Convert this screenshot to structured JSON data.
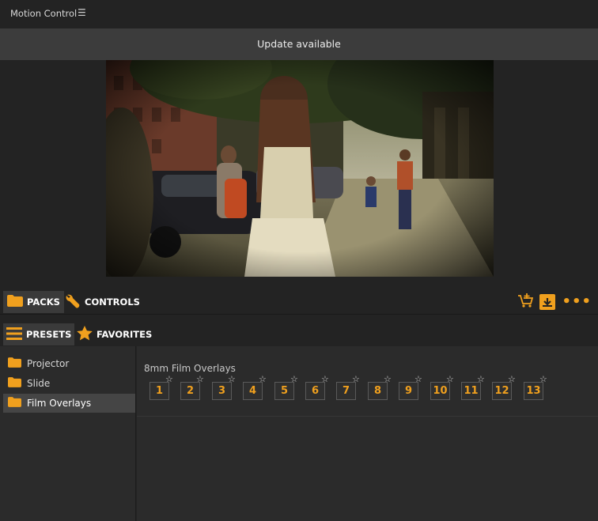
{
  "titlebar": {
    "title": "Motion Control",
    "menu_icon": "hamburger-menu-icon"
  },
  "update_banner": {
    "text": "Update available"
  },
  "preview": {
    "description_icon": "video-preview"
  },
  "packs_bar": {
    "packs_label": "PACKS",
    "controls_label": "CONTROLS",
    "active_tab": "PACKS"
  },
  "presets_bar": {
    "presets_label": "PRESETS",
    "favorites_label": "FAVORITES",
    "active_tab": "PRESETS"
  },
  "sidebar": {
    "items": [
      {
        "label": "Projector"
      },
      {
        "label": "Slide"
      },
      {
        "label": "Film Overlays"
      }
    ],
    "selected": "Film Overlays"
  },
  "content": {
    "pack_title": "8mm Film Overlays",
    "presets": [
      "1",
      "2",
      "3",
      "4",
      "5",
      "6",
      "7",
      "8",
      "9",
      "10",
      "11",
      "12",
      "13"
    ]
  },
  "colors": {
    "accent": "#f0a01e",
    "background": "#232323",
    "panel": "#2b2b2b",
    "banner": "#3c3c3c"
  }
}
